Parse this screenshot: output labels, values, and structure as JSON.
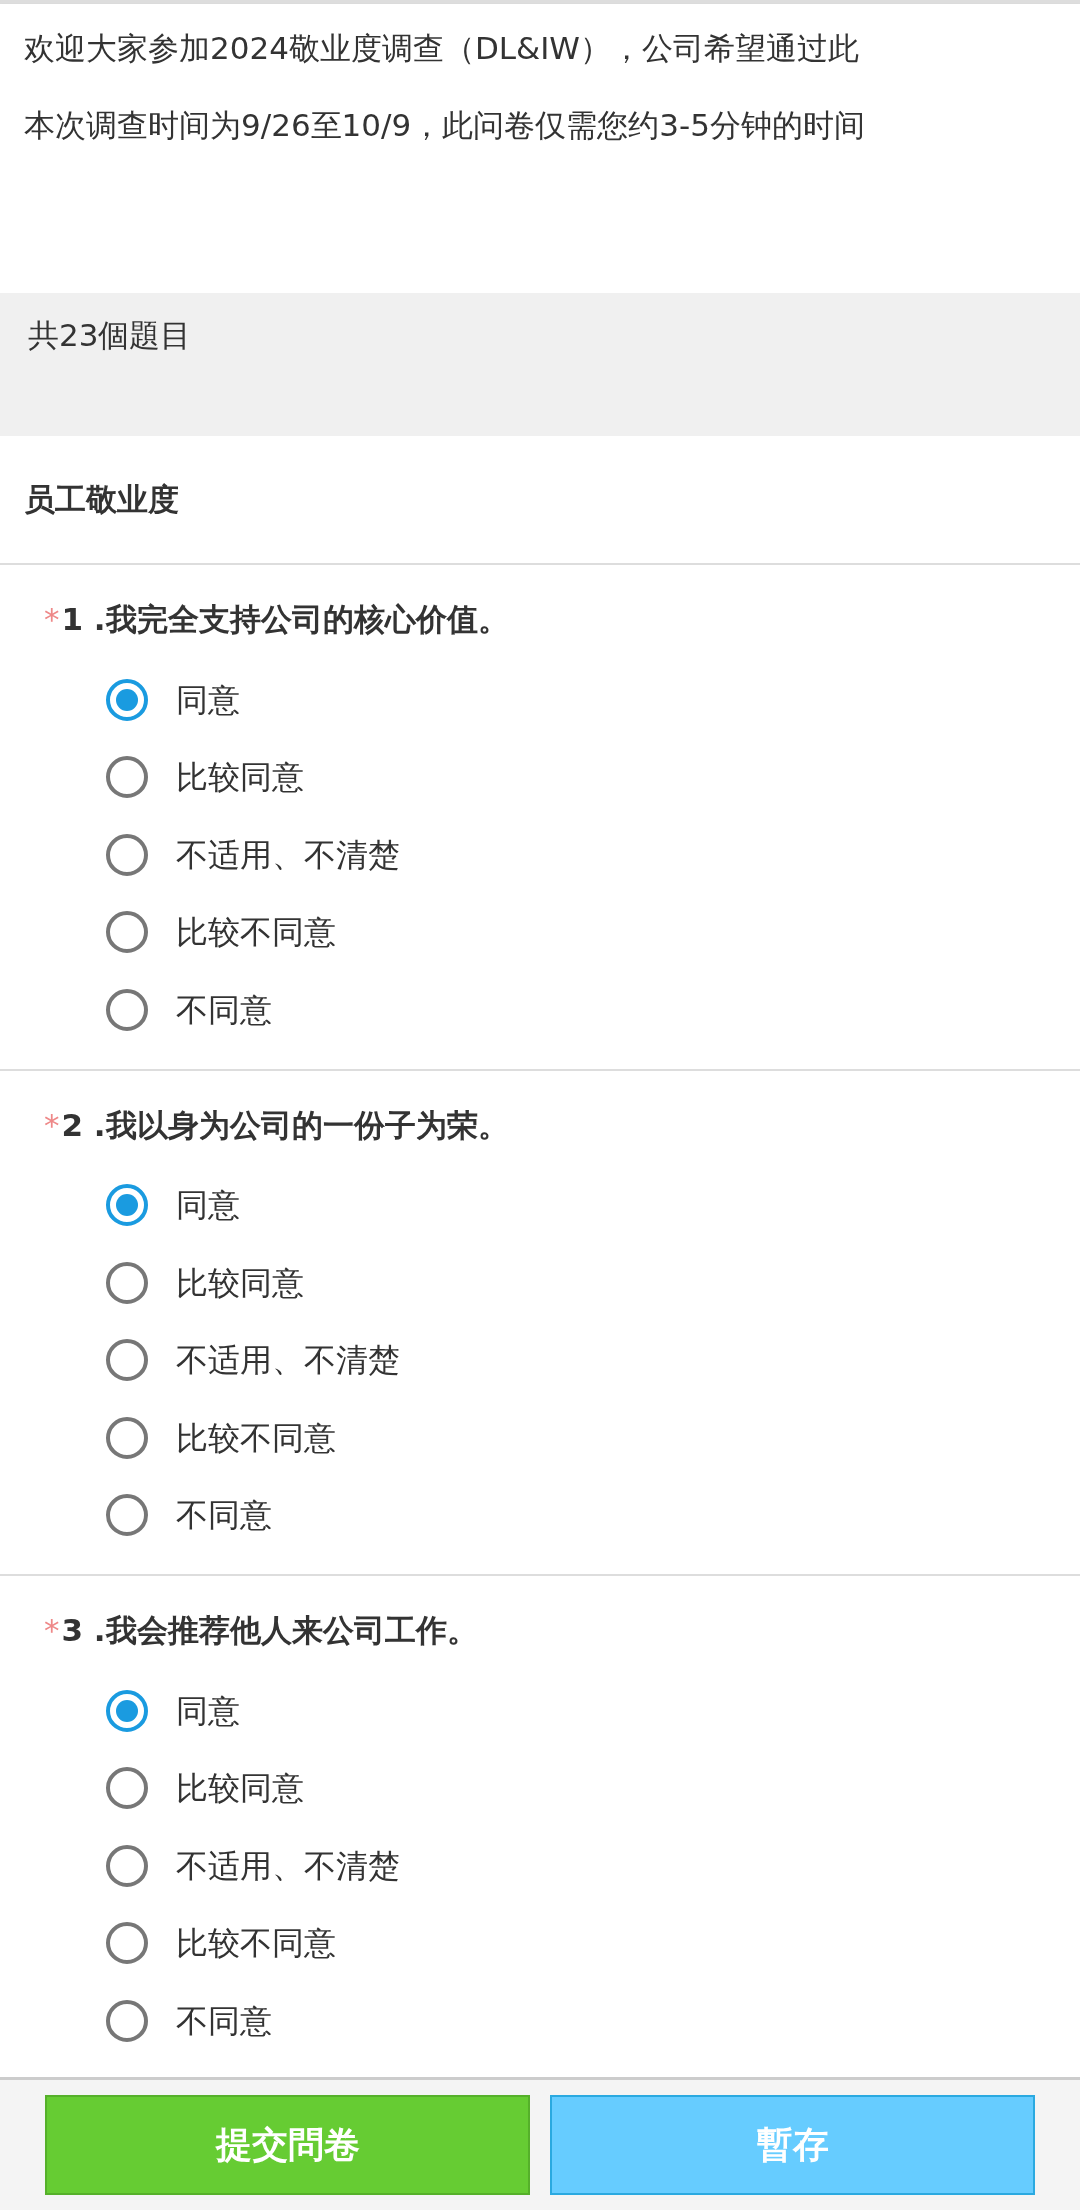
{
  "intro": {
    "paragraphs": [
      "欢迎大家参加2024敬业度调查（DL&IW），公司希望通过此",
      "本次调查时间为9/26至10/9，此问卷仅需您约3-5分钟的时间"
    ]
  },
  "question_count": "共23個題目",
  "section": {
    "title": "员工敬业度"
  },
  "questions": [
    {
      "required_mark": "*",
      "title": "1 .我完全支持公司的核心价值。",
      "options": [
        {
          "label": "同意",
          "selected": true
        },
        {
          "label": "比较同意",
          "selected": false
        },
        {
          "label": "不适用、不清楚",
          "selected": false
        },
        {
          "label": "比较不同意",
          "selected": false
        },
        {
          "label": "不同意",
          "selected": false
        }
      ]
    },
    {
      "required_mark": "*",
      "title": "2 .我以身为公司的一份子为荣。",
      "options": [
        {
          "label": "同意",
          "selected": true
        },
        {
          "label": "比较同意",
          "selected": false
        },
        {
          "label": "不适用、不清楚",
          "selected": false
        },
        {
          "label": "比较不同意",
          "selected": false
        },
        {
          "label": "不同意",
          "selected": false
        }
      ]
    },
    {
      "required_mark": "*",
      "title": "3 .我会推荐他人来公司工作。",
      "options": [
        {
          "label": "同意",
          "selected": true
        },
        {
          "label": "比较同意",
          "selected": false
        },
        {
          "label": "不适用、不清楚",
          "selected": false
        },
        {
          "label": "比较不同意",
          "selected": false
        },
        {
          "label": "不同意",
          "selected": false
        }
      ]
    }
  ],
  "buttons": [
    {
      "label": "提交問卷",
      "kind": "primary"
    },
    {
      "label": "暫存",
      "kind": "secondary"
    }
  ]
}
